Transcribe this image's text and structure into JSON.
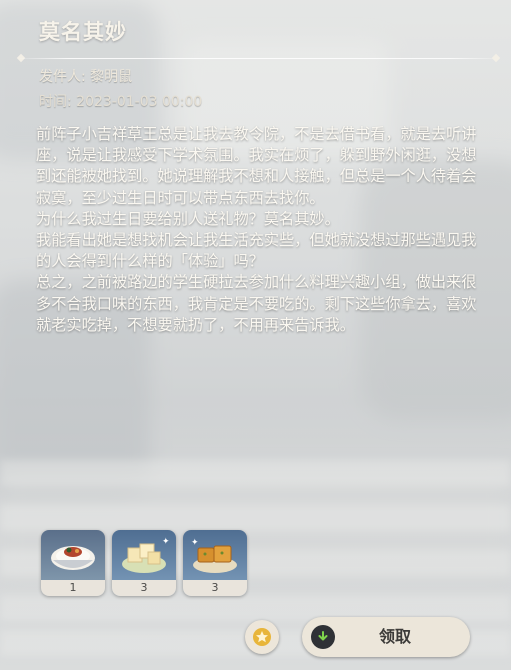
{
  "mail": {
    "title": "莫名其妙",
    "sender_label": "发件人: 黎明鼠",
    "time_label": "时间: 2023-01-03 00:00",
    "paragraphs": [
      "前阵子小吉祥草王总是让我去教令院，不是去借书看，就是去听讲座，说是让我感受下学术氛围。我实在烦了，躲到野外闲逛，没想到还能被她找到。她说理解我不想和人接触，但总是一个人待着会寂寞，至少过生日时可以带点东西去找你。",
      "为什么我过生日要给别人送礼物？莫名其妙。",
      "我能看出她是想找机会让我生活充实些，但她就没想过那些遇见我的人会得到什么样的「体验」吗？",
      "总之，之前被路边的学生硬拉去参加什么料理兴趣小组，做出来很多不合我口味的东西，我肯定是不要吃的。剩下这些你拿去，喜欢就老实吃掉，不想要就扔了，不用再来告诉我。"
    ]
  },
  "attachments": [
    {
      "icon": "rice-bowl-icon",
      "count": "1"
    },
    {
      "icon": "tofu-plate-icon",
      "count": "3"
    },
    {
      "icon": "fried-cake-icon",
      "count": "3"
    }
  ],
  "actions": {
    "claim_label": "领取"
  }
}
